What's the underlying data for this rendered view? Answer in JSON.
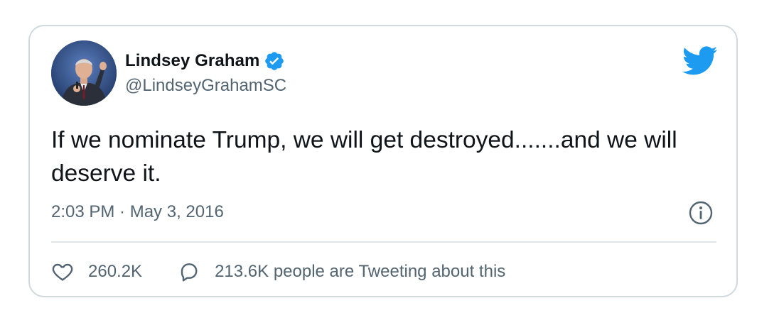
{
  "tweet": {
    "author": {
      "display_name": "Lindsey Graham",
      "handle": "@LindseyGrahamSC",
      "verified": true
    },
    "text": "If we nominate Trump, we will get destroyed.......and we will deserve it.",
    "timestamp": "2:03 PM · May 3, 2016",
    "likes": "260.2K",
    "replies_text": "213.6K people are Tweeting about this"
  },
  "colors": {
    "brand_blue": "#1d9bf0",
    "text_primary": "#0f1419",
    "text_secondary": "#536471",
    "border": "#cfd9de"
  },
  "icons": {
    "verified": "verified-badge-icon",
    "brand": "twitter-bird-icon",
    "info": "info-icon",
    "like": "heart-icon",
    "reply": "speech-bubble-icon"
  }
}
